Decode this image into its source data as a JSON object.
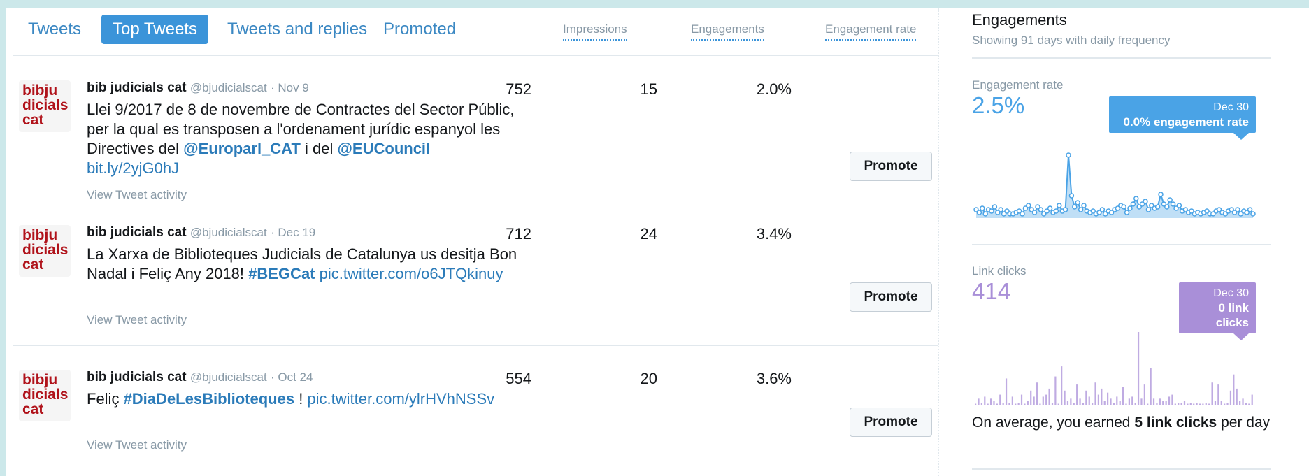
{
  "tabs": [
    {
      "label": "Tweets",
      "active": false
    },
    {
      "label": "Top Tweets",
      "active": true
    },
    {
      "label": "Tweets and replies",
      "active": false
    },
    {
      "label": "Promoted",
      "active": false
    }
  ],
  "columns": {
    "impressions": "Impressions",
    "engagements": "Engagements",
    "engagement_rate": "Engagement rate"
  },
  "avatar_lines": [
    "bibju",
    "dicials",
    "cat"
  ],
  "tweets": [
    {
      "name": "bib judicials cat",
      "handle": "@bjudicialscat",
      "date": "· Nov 9",
      "text_parts": [
        {
          "t": "Llei 9/2017 de 8 de novembre de Contractes del Sector Públic, per la qual es transposen a l'ordenament jurídic espanyol les Directives del ",
          "k": "text"
        },
        {
          "t": "@Europarl_CAT",
          "k": "mention"
        },
        {
          "t": " i del ",
          "k": "text"
        },
        {
          "t": "@EUCouncil",
          "k": "mention"
        },
        {
          "t": "   ",
          "k": "text"
        },
        {
          "t": "bit.ly/2yjG0hJ",
          "k": "link"
        }
      ],
      "view_activity": "View Tweet activity",
      "impressions": "752",
      "engagements": "15",
      "engagement_rate": "2.0%",
      "promote": "Promote"
    },
    {
      "name": "bib judicials cat",
      "handle": "@bjudicialscat",
      "date": "· Dec 19",
      "text_parts": [
        {
          "t": "La Xarxa de Biblioteques Judicials de Catalunya us desitja Bon Nadal i Feliç Any 2018! ",
          "k": "text"
        },
        {
          "t": "#BEGCat",
          "k": "mention"
        },
        {
          "t": " ",
          "k": "text"
        },
        {
          "t": "pic.twitter.com/o6JTQkinuy",
          "k": "link"
        }
      ],
      "view_activity": "View Tweet activity",
      "impressions": "712",
      "engagements": "24",
      "engagement_rate": "3.4%",
      "promote": "Promote"
    },
    {
      "name": "bib judicials cat",
      "handle": "@bjudicialscat",
      "date": "· Oct 24",
      "text_parts": [
        {
          "t": "Feliç ",
          "k": "text"
        },
        {
          "t": "#DiaDeLesBiblioteques",
          "k": "mention"
        },
        {
          "t": " ! ",
          "k": "text"
        },
        {
          "t": "pic.twitter.com/ylrHVhNSSv",
          "k": "link"
        }
      ],
      "view_activity": "View Tweet activity",
      "impressions": "554",
      "engagements": "20",
      "engagement_rate": "3.6%",
      "promote": "Promote"
    }
  ],
  "sidebar": {
    "title": "Engagements",
    "subtitle": "Showing 91 days with daily frequency",
    "engagement_rate": {
      "label": "Engagement rate",
      "value": "2.5%",
      "color": "#4aa3e6",
      "tooltip_date": "Dec 30",
      "tooltip_value": "0.0% engagement rate"
    },
    "link_clicks": {
      "label": "Link clicks",
      "value": "414",
      "color": "#a98fd8",
      "tooltip_date": "Dec 30",
      "tooltip_value": "0 link clicks"
    },
    "average": {
      "prefix": "On average, you earned ",
      "bold": "5 link clicks",
      "suffix": " per day"
    }
  },
  "chart_data": [
    {
      "type": "line",
      "ylabel": "",
      "series": [
        {
          "values": [
            0.6,
            0.4,
            0.7,
            0.3,
            0.6,
            0.5,
            0.8,
            0.4,
            0.6,
            0.3,
            0.5,
            0.3,
            0.3,
            0.4,
            0.5,
            0.3,
            0.7,
            0.9,
            0.6,
            0.4,
            0.8,
            0.6,
            0.3,
            0.5,
            0.7,
            0.4,
            0.5,
            0.9,
            0.5,
            0.6,
            4.5,
            1.6,
            0.8,
            1.1,
            0.6,
            0.9,
            0.5,
            0.4,
            0.5,
            0.3,
            0.4,
            0.6,
            0.3,
            0.5,
            0.4,
            0.6,
            0.7,
            0.9,
            0.8,
            0.4,
            0.7,
            1.0,
            1.4,
            0.8,
            1.0,
            1.2,
            0.6,
            0.9,
            0.7,
            0.8,
            1.7,
            1.0,
            0.8,
            1.3,
            1.0,
            0.7,
            0.9,
            0.5,
            0.6,
            0.4,
            0.5,
            0.3,
            0.4,
            0.3,
            0.4,
            0.5,
            0.3,
            0.3,
            0.5,
            0.6,
            0.4,
            0.3,
            0.5,
            0.6,
            0.4,
            0.6,
            0.3,
            0.5,
            0.4,
            0.6,
            0.3
          ]
        }
      ]
    },
    {
      "type": "bar",
      "ylabel": "",
      "values": [
        0,
        3,
        1,
        4,
        0,
        3,
        2,
        0,
        5,
        1,
        13,
        1,
        4,
        0,
        1,
        5,
        0,
        2,
        7,
        4,
        11,
        0,
        4,
        5,
        8,
        1,
        14,
        0,
        19,
        7,
        2,
        3,
        1,
        10,
        3,
        1,
        7,
        4,
        1,
        11,
        5,
        8,
        2,
        6,
        3,
        1,
        4,
        2,
        9,
        0,
        3,
        4,
        1,
        36,
        3,
        10,
        0,
        18,
        3,
        1,
        3,
        2,
        2,
        4,
        5,
        0,
        1,
        1,
        2,
        0,
        1,
        0,
        1,
        0,
        0,
        1,
        0,
        11,
        2,
        10,
        2,
        0,
        1,
        7,
        15,
        8,
        2,
        3,
        1,
        0,
        5
      ]
    }
  ]
}
